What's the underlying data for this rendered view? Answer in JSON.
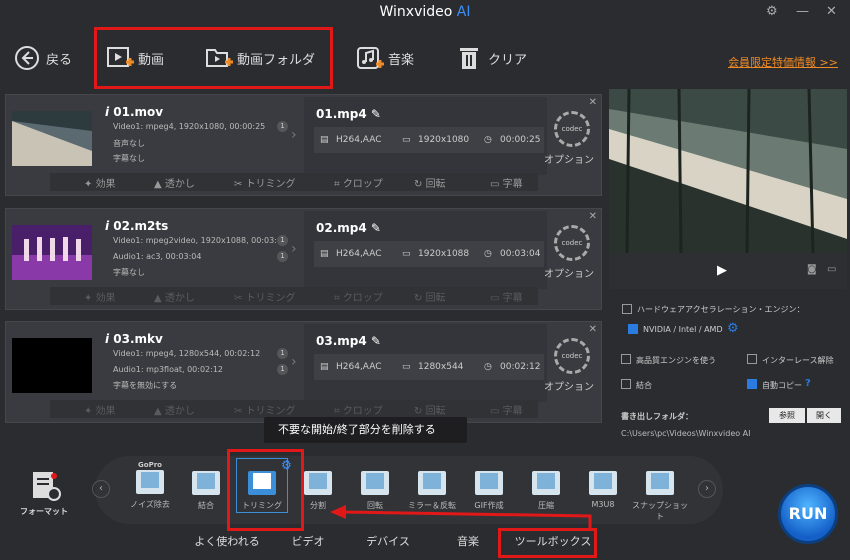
{
  "title": {
    "app": "Winxvideo",
    "ai": "AI"
  },
  "toolbar": {
    "back": "戻る",
    "video": "動画",
    "video_folder": "動画フォルダ",
    "music": "音楽",
    "clear": "クリア",
    "promo": "会員限定特価情報 >>"
  },
  "items": [
    {
      "name": "01.mov",
      "v": "Video1: mpeg4, 1920x1080, 00:00:25",
      "a": "音声なし",
      "s": "字幕なし",
      "out": "01.mp4",
      "codec": "H264,AAC",
      "res": "1920x1080",
      "dur": "00:00:25"
    },
    {
      "name": "02.m2ts",
      "v": "Video1: mpeg2video, 1920x1088, 00:03:04",
      "a": "Audio1: ac3, 00:03:04",
      "s": "字幕なし",
      "out": "02.mp4",
      "codec": "H264,AAC",
      "res": "1920x1088",
      "dur": "00:03:04"
    },
    {
      "name": "03.mkv",
      "v": "Video1: mpeg4, 1280x544, 00:02:12",
      "a": "Audio1: mp3float, 00:02:12",
      "s": "字幕を無効にする",
      "out": "03.mp4",
      "codec": "H264,AAC",
      "res": "1280x544",
      "dur": "00:02:12"
    }
  ],
  "common": {
    "count": "1",
    "codec_badge": "codec",
    "option": "オプション",
    "effect": "効果",
    "watermark": "透かし",
    "trim": "トリミング",
    "crop": "クロップ",
    "rotate": "回転",
    "subtitle": "字幕"
  },
  "settings": {
    "hw_accel": "ハードウェアアクセラレーション・エンジン：",
    "nvidia": "NVIDIA / Intel / AMD",
    "hq": "高品質エンジンを使う",
    "deinterlace": "インターレース解除",
    "merge": "結合",
    "autocopy": "自動コピー",
    "help": "?",
    "output_folder": "書き出しフォルダ：",
    "browse": "参照",
    "open": "開く",
    "path": "C:\\Users\\pc\\Videos\\Winxvideo AI"
  },
  "tooltip": "不要な開始/終了部分を削除する",
  "format_label": "フォーマット",
  "tools": [
    {
      "label": "ノイズ除去",
      "brand": "GoPro"
    },
    {
      "label": "結合"
    },
    {
      "label": "トリミング"
    },
    {
      "label": "分割"
    },
    {
      "label": "回転"
    },
    {
      "label": "ミラー＆反転"
    },
    {
      "label": "GIF作成"
    },
    {
      "label": "圧縮"
    },
    {
      "label": "M3U8"
    },
    {
      "label": "スナップショット"
    }
  ],
  "tabs": [
    "よく使われる",
    "ビデオ",
    "デバイス",
    "音楽",
    "ツールボックス"
  ],
  "run": "RUN",
  "colors": {
    "accent": "#3d8ff5",
    "highlight": "#e01818",
    "promo": "#f08a24"
  }
}
